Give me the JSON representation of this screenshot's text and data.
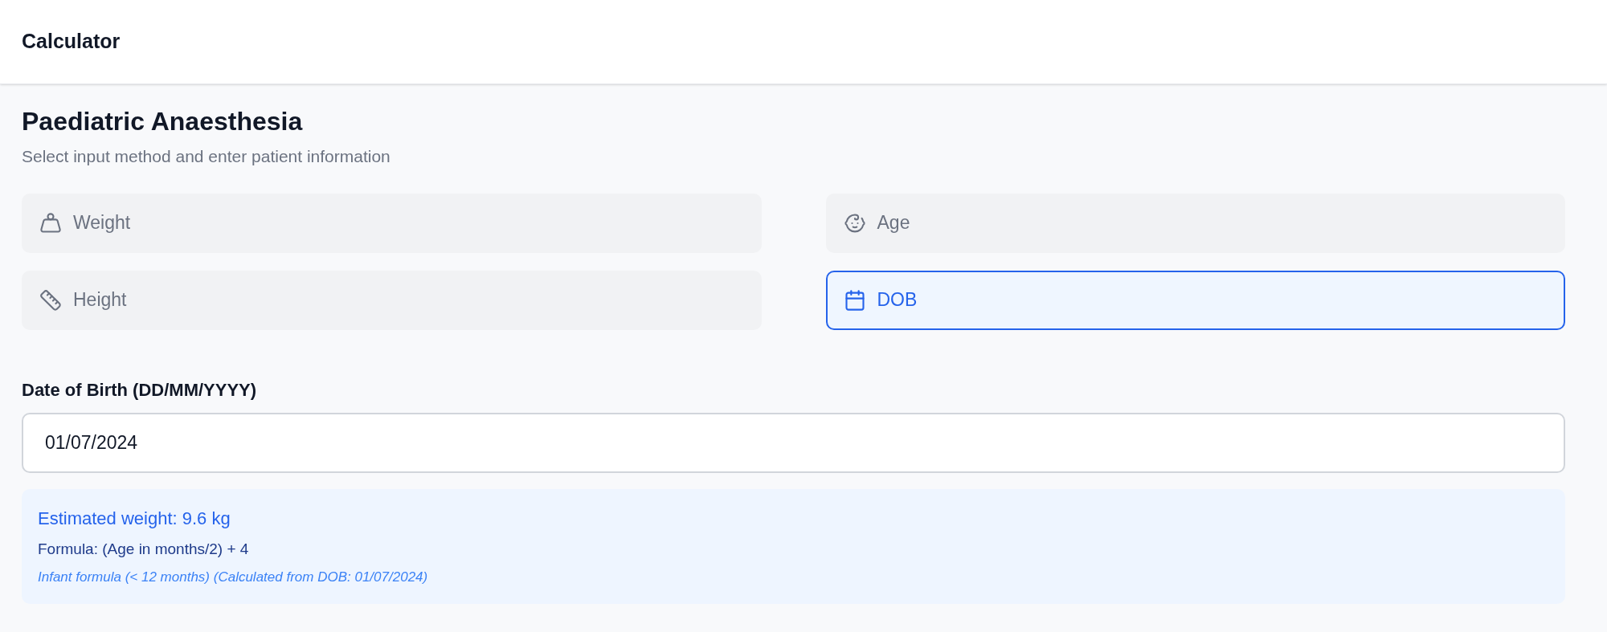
{
  "header": {
    "title": "Calculator"
  },
  "page": {
    "title": "Paediatric Anaesthesia",
    "subtitle": "Select input method and enter patient information"
  },
  "methods": [
    {
      "label": "Weight",
      "selected": false
    },
    {
      "label": "Age",
      "selected": false
    },
    {
      "label": "Height",
      "selected": false
    },
    {
      "label": "DOB",
      "selected": true
    }
  ],
  "dob_field": {
    "label": "Date of Birth (DD/MM/YYYY)",
    "value": "01/07/2024"
  },
  "result": {
    "estimate": "Estimated weight: 9.6 kg",
    "formula": "Formula: (Age in months/2) + 4",
    "note": "Infant formula (< 12 months) (Calculated from DOB: 01/07/2024)"
  }
}
